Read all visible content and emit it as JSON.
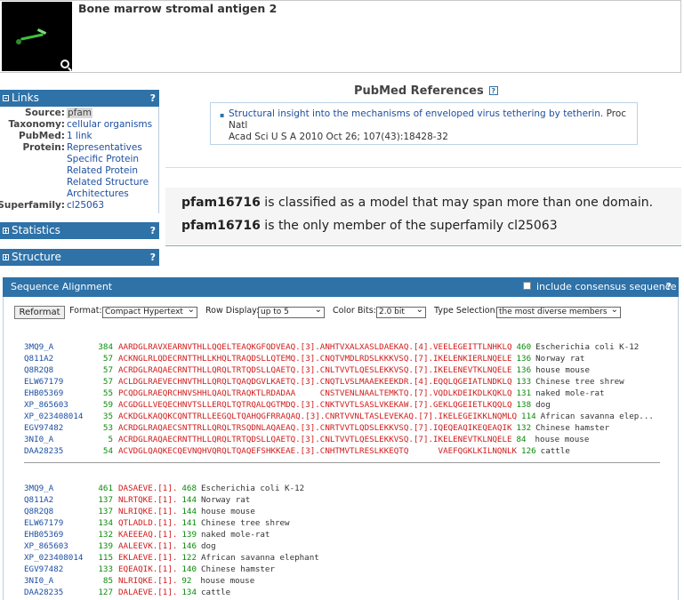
{
  "header": {
    "title": "Bone marrow stromal antigen 2"
  },
  "links_panel": {
    "heading": "Links",
    "help": "?",
    "rows": [
      {
        "key": "Source:",
        "values": [
          "pfam"
        ]
      },
      {
        "key": "Taxonomy:",
        "values": [
          "cellular organisms"
        ]
      },
      {
        "key": "PubMed:",
        "values": [
          "1 link"
        ]
      },
      {
        "key": "Protein:",
        "values": [
          "Representatives",
          "Specific Protein",
          "Related Protein",
          "Related Structure",
          "Architectures"
        ]
      },
      {
        "key": "Superfamily:",
        "values": [
          "cl25063"
        ]
      }
    ]
  },
  "statistics_panel": {
    "heading": "Statistics",
    "help": "?"
  },
  "structure_panel": {
    "heading": "Structure",
    "help": "?"
  },
  "pubmed": {
    "heading": "PubMed References",
    "help": "?",
    "citation_link": "Structural insight into the mechanisms of enveloped virus tethering by tetherin.",
    "citation_rest_1": " Proc Natl",
    "citation_rest_2": "Acad Sci U S A 2010 Oct 26; 107(43):18428-32"
  },
  "classification": {
    "line1_id": "pfam16716",
    "line1_text": " is classified as a model that may span more than one domain.",
    "line2_id": "pfam16716",
    "line2_text": " is the only member of the superfamily cl25063"
  },
  "alignment": {
    "heading": "Sequence Alignment",
    "consensus_label": "include consensus sequence",
    "help": "?",
    "reformat_button": "Reformat",
    "format_label": "Format:",
    "format_value": "Compact Hypertext",
    "row_display_label": "Row Display:",
    "row_display_value": "up to 5",
    "color_bits_label": "Color Bits:",
    "color_bits_value": "2.0 bit",
    "type_selection_label": "Type Selection:",
    "type_selection_value": "the most diverse members",
    "block1": [
      {
        "acc": "3MQ9_A",
        "from": "384",
        "seq": "AARDGLRAVXEARNVTHLLQQELTEAQKGFQDVEAQ.[3].ANHTVXALXASLDAEKAQ.[4].VEELEGEITTLNHKLQ",
        "to": "460",
        "org": "Escherichia coli K-12"
      },
      {
        "acc": "Q811A2",
        "from": "57",
        "seq": "ACKNGLRLQDECRNTTHLLKHQLTRAQDSLLQTEMQ.[3].CNQTVMDLRDSLKKKVSQ.[7].IKELENKIERLNQELE",
        "to": "136",
        "org": "Norway rat"
      },
      {
        "acc": "Q8R2Q8",
        "from": "57",
        "seq": "ACRDGLRAQAECRNTTHLLQRQLTRTQDSLLQAETQ.[3].CNLTVVTLQESLEKKVSQ.[7].IKELENEVTKLNQELE",
        "to": "136",
        "org": "house mouse"
      },
      {
        "acc": "ELW67179",
        "from": "57",
        "seq": "ACLDGLRAEVECHNVTHLLQRQLTQAQDGVLKAETQ.[3].CNQTLVSLMAAEKEEKDR.[4].EQQLQGEIATLNDKLQ",
        "to": "133",
        "org": "Chinese tree shrew"
      },
      {
        "acc": "EHB05369",
        "from": "55",
        "seq": "PCQDGLRAEQRCHNVSHHLQAQLTRAQKTLRDADAA     CNSTVENLNAALTEMKTQ.[7].VQDLKDEIKDLKQKLQ",
        "to": "131",
        "org": "naked mole-rat"
      },
      {
        "acc": "XP_865603",
        "from": "59",
        "seq": "ACGDGLLVEQECHNVTSLLERQLTQTRQALQGTMDQ.[3].CNKTVVTLSASLVKEKAW.[7].GEKLQGEIETLKQQLQ",
        "to": "138",
        "org": "dog"
      },
      {
        "acc": "XP_023408014",
        "from": "35",
        "seq": "ACKDGLKAQQKCQNTTRLLEEGQLTQAHQGFRRAQAQ.[3].CNRTVVNLTASLEVEKAQ.[7].IKELEGEIKKLNQMLQ",
        "to": "114",
        "org": "African savanna elep..."
      },
      {
        "acc": "EGV97482",
        "from": "53",
        "seq": "ACRDGLRAQAECSNTTRLLQRQLTRSQDNLAQAEAQ.[3].CNRTVVTLQDSLEKKVSQ.[7].IQEQEAQIKEQEAQIK",
        "to": "132",
        "org": "Chinese hamster"
      },
      {
        "acc": "3NI0_A",
        "from": "5",
        "seq": "ACRDGLRAQAECRNTTHLLQRQLTRTQDSLLQAETQ.[3].CNLTVVTLQESLEKKVSQ.[7].IKELENEVTKLNQELE",
        "to": "84",
        "org": "house mouse"
      },
      {
        "acc": "DAA28235",
        "from": "54",
        "seq": "ACVDGLQAQKECQEVNQHVQRQLTQAQEFSHKKEAE.[3].CNHTMVTLRESLKKEQTQ      VAEFQGKLKILNQNLK",
        "to": "126",
        "org": "cattle"
      }
    ],
    "block2": [
      {
        "acc": "3MQ9_A",
        "from": "461",
        "seq": "DASAEVE.[1].",
        "to": "468",
        "org": "Escherichia coli K-12"
      },
      {
        "acc": "Q811A2",
        "from": "137",
        "seq": "NLRTQKE.[1].",
        "to": "144",
        "org": "Norway rat"
      },
      {
        "acc": "Q8R2Q8",
        "from": "137",
        "seq": "NLRIQKE.[1].",
        "to": "144",
        "org": "house mouse"
      },
      {
        "acc": "ELW67179",
        "from": "134",
        "seq": "QTLADLD.[1].",
        "to": "141",
        "org": "Chinese tree shrew"
      },
      {
        "acc": "EHB05369",
        "from": "132",
        "seq": "KAEEEAQ.[1].",
        "to": "139",
        "org": "naked mole-rat"
      },
      {
        "acc": "XP_865603",
        "from": "139",
        "seq": "AALEEVK.[1].",
        "to": "146",
        "org": "dog"
      },
      {
        "acc": "XP_023408014",
        "from": "115",
        "seq": "EKLAEVE.[1].",
        "to": "122",
        "org": "African savanna elephant"
      },
      {
        "acc": "EGV97482",
        "from": "133",
        "seq": "EQEAQIK.[1].",
        "to": "140",
        "org": "Chinese hamster"
      },
      {
        "acc": "3NI0_A",
        "from": "85",
        "seq": "NLRIQKE.[1].",
        "to": "92",
        "org": "house mouse"
      },
      {
        "acc": "DAA28235",
        "from": "127",
        "seq": "DALAEVE.[1].",
        "to": "134",
        "org": "cattle"
      }
    ]
  }
}
